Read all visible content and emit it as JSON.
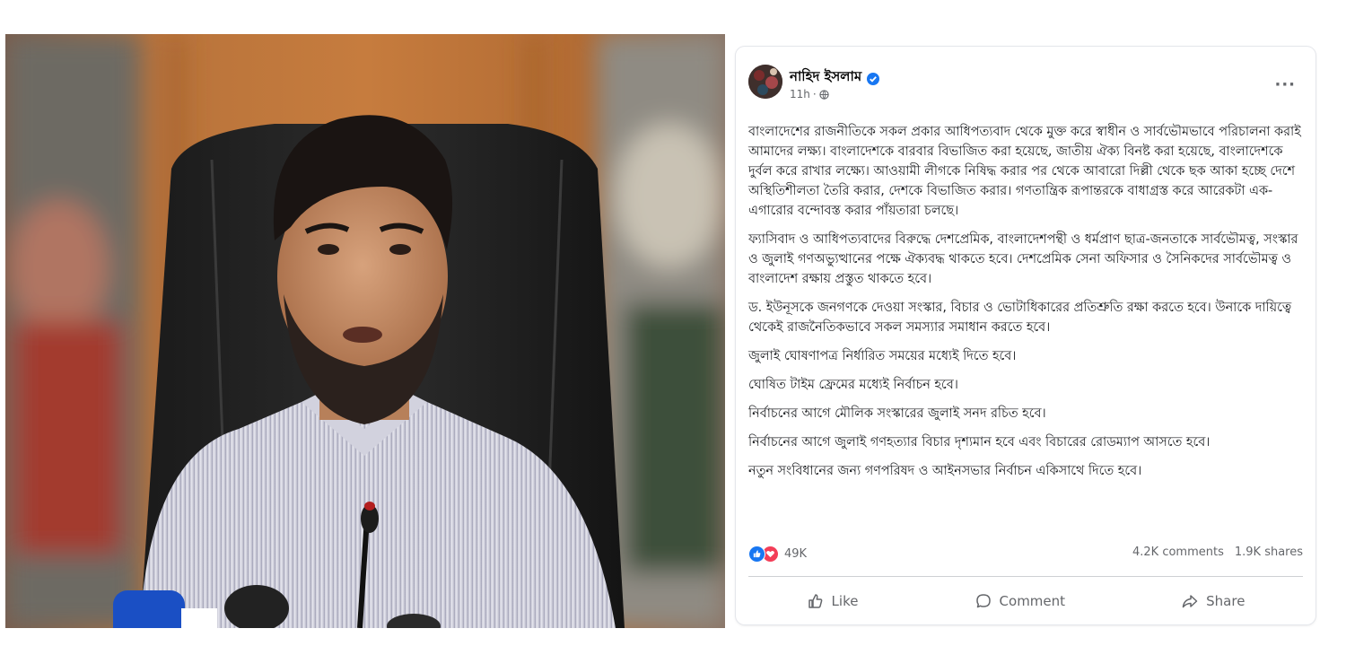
{
  "post": {
    "author": "নাহিদ ইসলাম",
    "time": "11h",
    "more": "···",
    "paragraphs": [
      "বাংলাদেশের রাজনীতিকে সকল প্রকার আধিপত্যবাদ থেকে মুক্ত করে স্বাধীন ও সার্বভৌমভাবে পরিচালনা করাই আমাদের লক্ষ্য। বাংলাদেশকে বারবার বিভাজিত করা হয়েছে, জাতীয় ঐক্য বিনষ্ট করা হয়েছে, বাংলাদেশকে দুর্বল করে রাখার লক্ষ্যে। আওয়ামী লীগকে নিষিদ্ধ করার পর থেকে আবারো দিল্লী থেকে ছক আকা হচ্ছে দেশে অস্থিতিশীলতা তৈরি করার, দেশকে বিভাজিত করার। গণতান্ত্রিক রূপান্তরকে বাধাগ্রস্ত করে আরেকটা এক-এগারোর বন্দোবস্ত করার পাঁয়তারা চলছে।",
      "ফ্যাসিবাদ ও আধিপত্যবাদের বিরুদ্ধে দেশপ্রেমিক, বাংলাদেশপন্থী ও ধর্মপ্রাণ ছাত্র-জনতাকে সার্বভৌমত্ব, সংস্কার ও জুলাই গণঅভ্যুত্থানের পক্ষে ঐক্যবদ্ধ থাকতে হবে। দেশপ্রেমিক সেনা অফিসার ও সৈনিকদের সার্বভৌমত্ব ও বাংলাদেশ রক্ষায় প্রস্তুত থাকতে হবে।",
      "ড. ইউনূসকে জনগণকে দেওয়া সংস্কার, বিচার ও ভোটাধিকারের প্রতিশ্রুতি রক্ষা করতে হবে। উনাকে দায়িত্বে থেকেই রাজনৈতিকভাবে সকল সমস্যার সমাধান করতে হবে।",
      "জুলাই ঘোষণাপত্র নির্ধারিত সময়ের মধ্যেই দিতে হবে।",
      "ঘোষিত টাইম ফ্রেমের মধ্যেই নির্বাচন হবে।",
      "নির্বাচনের আগে মৌলিক সংস্কারের জুলাই সনদ রচিত হবে।",
      "নির্বাচনের আগে জুলাই গণহত্যার বিচার দৃশ্যমান হবে এবং বিচারের রোডম্যাপ আসতে হবে।",
      "নতুন সংবিধানের জন্য গণপরিষদ ও আইনসভার নির্বাচন একিসাথে দিতে হবে।"
    ],
    "reactions": "49K",
    "comments": "4.2K comments",
    "shares": "1.9K shares",
    "actions": {
      "like": "Like",
      "comment": "Comment",
      "share": "Share"
    }
  },
  "colors": {
    "accent": "#1877f2",
    "love": "#f33e58",
    "muted": "#65676b"
  },
  "icons": [
    "verified-badge-icon",
    "globe-icon",
    "like-reaction-icon",
    "love-reaction-icon",
    "thumbs-up-icon",
    "comment-icon",
    "share-icon"
  ]
}
